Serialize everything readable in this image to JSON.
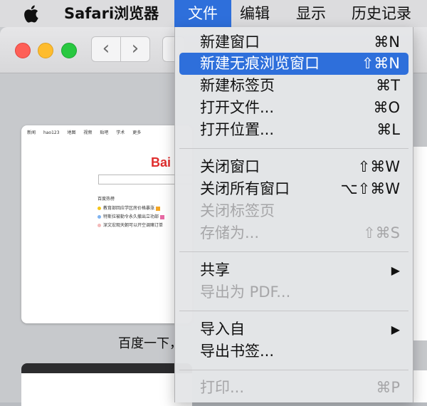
{
  "menubar": {
    "app_name": "Safari浏览器",
    "items": [
      "文件",
      "编辑",
      "显示",
      "历史记录"
    ]
  },
  "browser": {
    "back_glyph": "‹",
    "forward_glyph": "›",
    "thumbnail": {
      "nav_links": [
        "新闻",
        "hao123",
        "地图",
        "视频",
        "贴吧",
        "学术",
        "更多"
      ],
      "logo_text": "Bai",
      "hot_title": "百度热榜",
      "hot_items": [
        {
          "text": "教育部回应学区房价格暴涨",
          "tag_color": "#f5a623"
        },
        {
          "text": "特斯拉被勒令永久撤出立功部",
          "tag_color": "#e86aa5"
        },
        {
          "text": "深文宏观天朝可以开空调赌订单",
          "tag_color": ""
        }
      ],
      "caption": "百度一下，"
    }
  },
  "file_menu": {
    "items": [
      {
        "label": "新建窗口",
        "shortcut": "⌘N",
        "state": "normal"
      },
      {
        "label": "新建无痕浏览窗口",
        "shortcut": "⇧⌘N",
        "state": "selected"
      },
      {
        "label": "新建标签页",
        "shortcut": "⌘T",
        "state": "normal"
      },
      {
        "label": "打开文件...",
        "shortcut": "⌘O",
        "state": "normal"
      },
      {
        "label": "打开位置...",
        "shortcut": "⌘L",
        "state": "normal"
      },
      {
        "label": "关闭窗口",
        "shortcut": "⇧⌘W",
        "state": "normal"
      },
      {
        "label": "关闭所有窗口",
        "shortcut": "⌥⇧⌘W",
        "state": "normal"
      },
      {
        "label": "关闭标签页",
        "shortcut": "",
        "state": "disabled"
      },
      {
        "label": "存储为...",
        "shortcut": "⇧⌘S",
        "state": "disabled"
      },
      {
        "label": "共享",
        "shortcut": "▶",
        "state": "normal"
      },
      {
        "label": "导出为 PDF...",
        "shortcut": "",
        "state": "disabled"
      },
      {
        "label": "导入自",
        "shortcut": "▶",
        "state": "normal"
      },
      {
        "label": "导出书签...",
        "shortcut": "",
        "state": "normal"
      },
      {
        "label": "打印...",
        "shortcut": "⌘P",
        "state": "disabled"
      }
    ]
  },
  "colors": {
    "accent": "#2e6fdb",
    "disabled_text": "#a6a6a8"
  }
}
